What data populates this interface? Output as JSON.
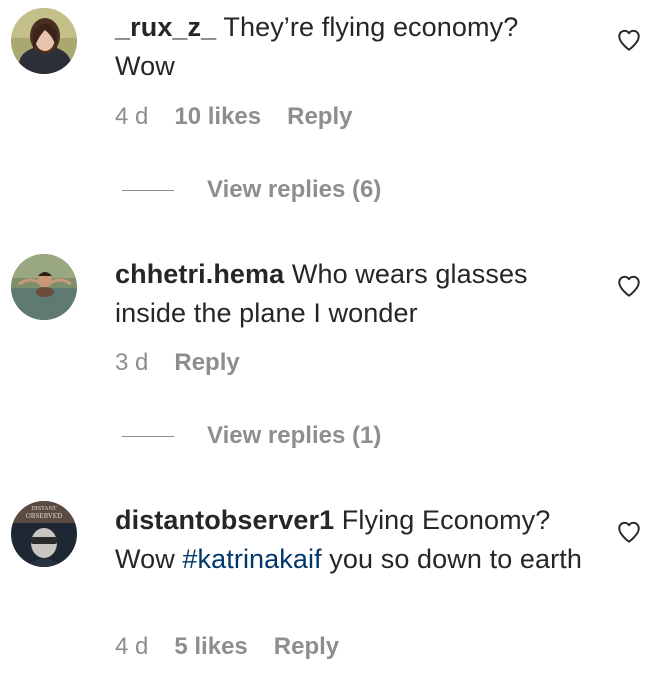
{
  "comments": [
    {
      "username": "_rux_z_",
      "text": " They’re flying economy? Wow",
      "time": "4 d",
      "likes": "10 likes",
      "reply_label": "Reply",
      "avatar_icon": "profile-photo-woman",
      "like_icon": "heart-outline-icon"
    },
    {
      "username": "chhetri.hema",
      "text": " Who wears glasses inside the plane I wonder",
      "time": "3 d",
      "likes": "",
      "reply_label": "Reply",
      "avatar_icon": "profile-photo-swimmer",
      "like_icon": "heart-outline-icon"
    },
    {
      "username": "distantobserver1",
      "text_before": " Flying Economy? Wow ",
      "hashtag": "#katrinakaif",
      "text_after": " you so down to earth",
      "time": "4 d",
      "likes": "5 likes",
      "reply_label": "Reply",
      "avatar_icon": "profile-photo-observed",
      "avatar_text": "DISTANT OBSERVED",
      "like_icon": "heart-outline-icon"
    }
  ],
  "view_replies": [
    {
      "label": "View replies (6)"
    },
    {
      "label": "View replies (1)"
    }
  ],
  "colors": {
    "text": "#262626",
    "secondary": "#8e8e8e",
    "hashtag": "#00376b",
    "background": "#ffffff"
  }
}
